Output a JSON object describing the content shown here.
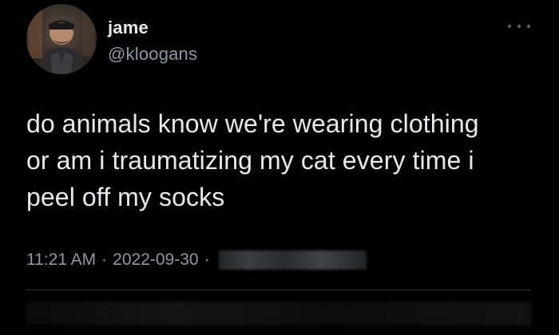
{
  "user": {
    "display_name": "jame",
    "handle": "@kloogans"
  },
  "tweet": {
    "lines": [
      "do animals know we're wearing clothing",
      "or am i traumatizing my cat every time i",
      "peel off my socks"
    ]
  },
  "meta": {
    "time": "11:21 AM",
    "separator": "·",
    "date": "2022-09-30"
  },
  "icons": {
    "more": "more-horizontal-icon",
    "avatar": "avatar"
  },
  "colors": {
    "background": "#000000",
    "text": "#e7e9ea",
    "secondary": "#8b98a5",
    "divider": "#2f3336"
  }
}
